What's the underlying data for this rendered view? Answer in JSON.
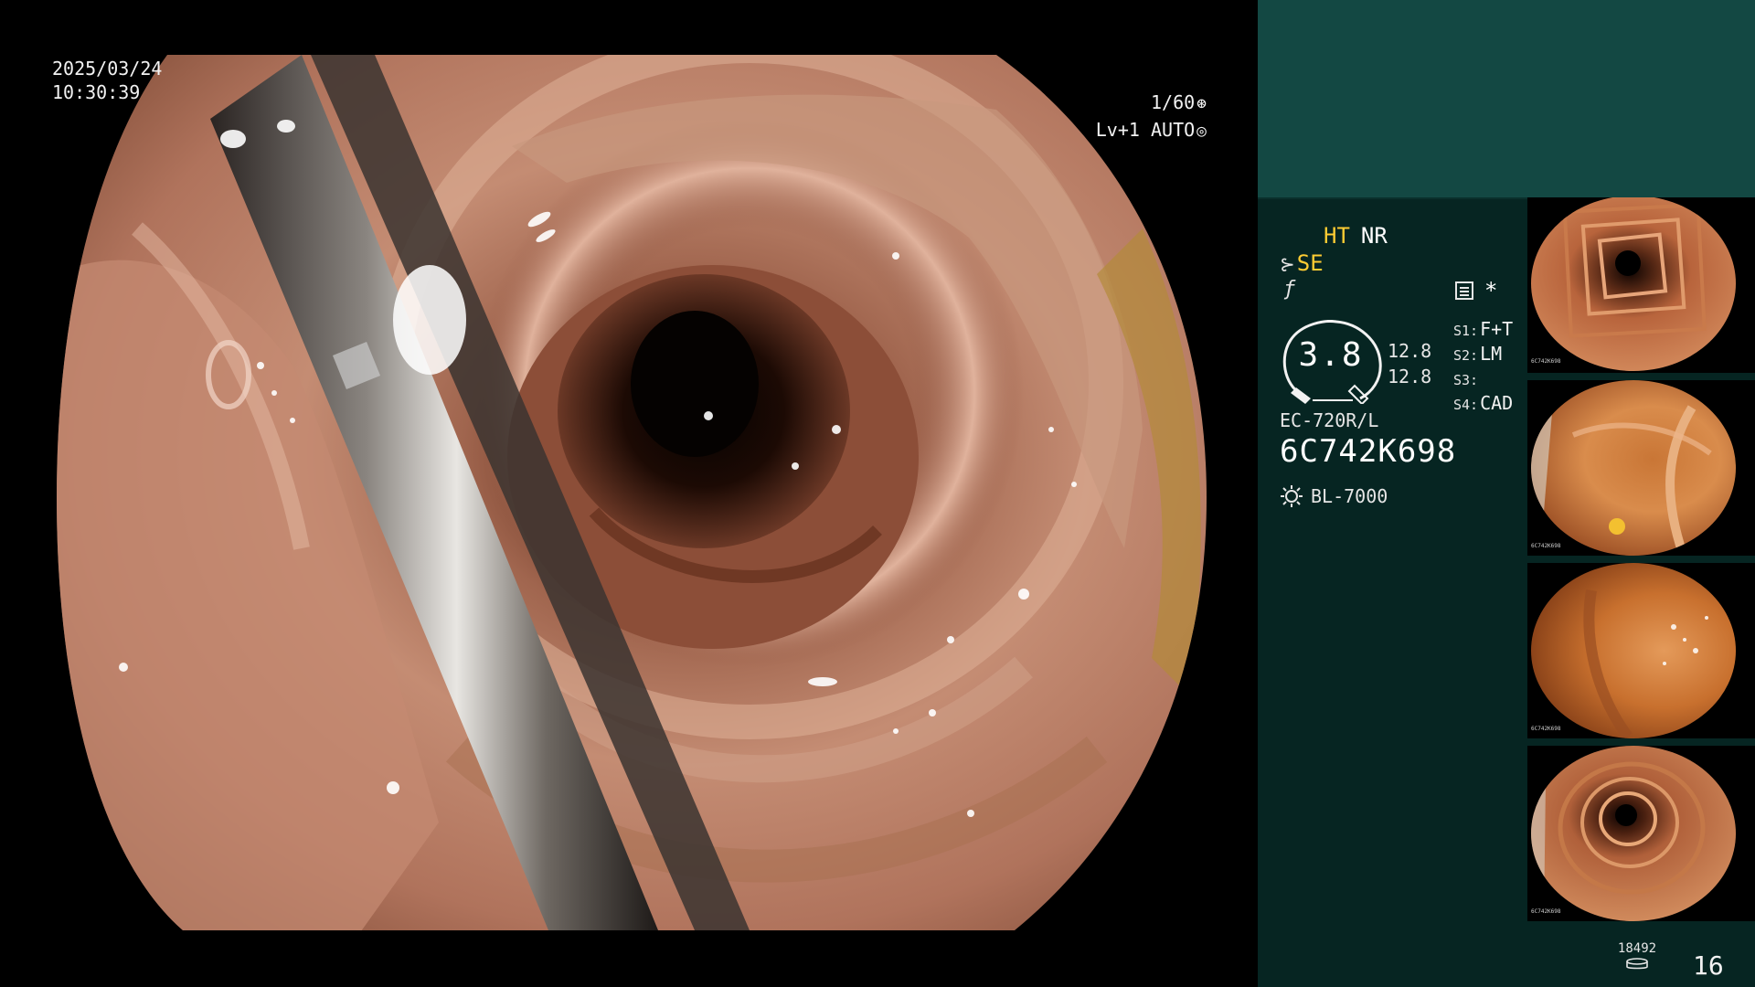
{
  "overlay": {
    "date": "2025/03/24",
    "time": "10:30:39",
    "shutter": "1/60",
    "level": "Lv+1",
    "mode": "AUTO",
    "shutter_icon": "aperture-icon",
    "mode_icon": "iris-icon"
  },
  "settings": {
    "ht_label": "HT",
    "nr_label": "NR",
    "se_label": "SE",
    "dial_value": "3.8",
    "readout_1": "12.8",
    "readout_2": "12.8",
    "s_items": [
      {
        "key": "S1:",
        "value": "F+T"
      },
      {
        "key": "S2:",
        "value": "LM"
      },
      {
        "key": "S3:",
        "value": ""
      },
      {
        "key": "S4:",
        "value": "CAD"
      }
    ],
    "scope_model": "EC-720R/L",
    "scope_serial": "6C742K698",
    "light_source": "BL-7000",
    "colors": {
      "highlight": "#ffcc33",
      "panel": "#062522",
      "header": "#134843"
    }
  },
  "thumbnails": [
    {
      "label": "6C742K698"
    },
    {
      "label": "6C742K698"
    },
    {
      "label": "6C742K698"
    },
    {
      "label": "6C742K698"
    }
  ],
  "storage": {
    "count": "18492",
    "page": "16",
    "icon": "storage-stack-icon"
  }
}
